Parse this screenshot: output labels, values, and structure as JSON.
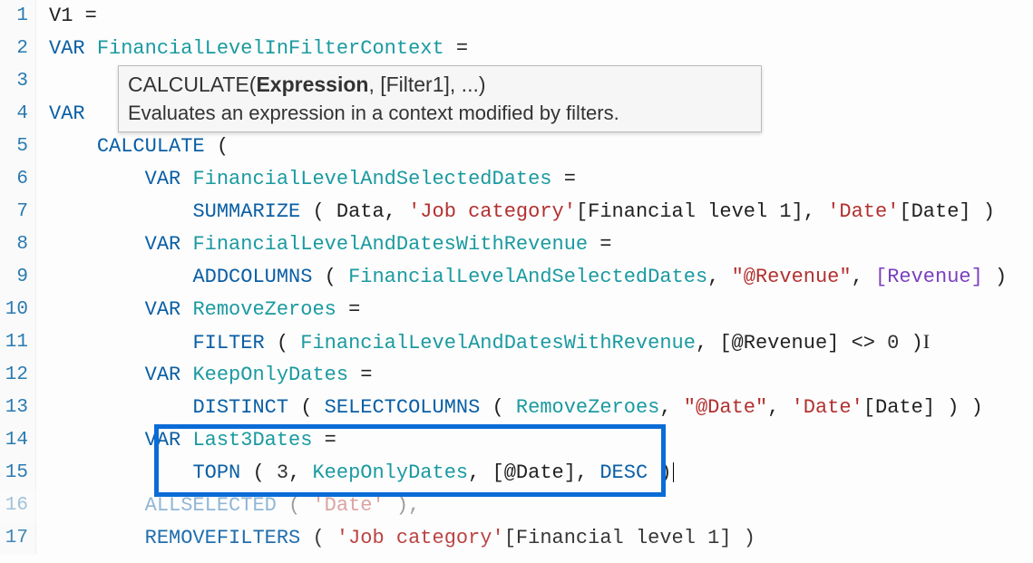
{
  "tooltip": {
    "signature_prefix": "CALCULATE(",
    "signature_bold": "Expression",
    "signature_suffix": ", [Filter1], ...)",
    "description": "Evaluates an expression in a context modified by filters."
  },
  "lines": {
    "l1": {
      "num": "1",
      "a": "V1 =",
      "ident": ""
    },
    "l2": {
      "num": "2",
      "kw": "VAR",
      "ident": "FinancialLevelInFilterContext",
      "rest": " ="
    },
    "l3": {
      "num": "3"
    },
    "l4": {
      "num": "4",
      "kw": "VAR"
    },
    "l5": {
      "num": "5",
      "fn": "CALCULATE",
      "rest": " ("
    },
    "l6": {
      "num": "6",
      "kw": "VAR",
      "ident": "FinancialLevelAndSelectedDates",
      "rest": " ="
    },
    "l7": {
      "num": "7",
      "fn": "SUMMARIZE",
      "rest1": " ( Data, ",
      "str1": "'Job category'",
      "rest2": "[Financial level 1], ",
      "str2": "'Date'",
      "rest3": "[Date] )"
    },
    "l8": {
      "num": "8",
      "kw": "VAR",
      "ident": "FinancialLevelAndDatesWithRevenue",
      "rest": " ="
    },
    "l9": {
      "num": "9",
      "fn": "ADDCOLUMNS",
      "rest1": " ( ",
      "ident2": "FinancialLevelAndSelectedDates",
      "rest2": ", ",
      "str1": "\"@Revenue\"",
      "rest3": ", ",
      "col1": "[Revenue]",
      "rest4": " )"
    },
    "l10": {
      "num": "10",
      "kw": "VAR",
      "ident": "RemoveZeroes",
      "rest": " ="
    },
    "l11": {
      "num": "11",
      "fn": "FILTER",
      "rest1": " ( ",
      "ident2": "FinancialLevelAndDatesWithRevenue",
      "rest2": ", [@Revenue] <> ",
      "num1": "0",
      "rest3": " )"
    },
    "l12": {
      "num": "12",
      "kw": "VAR",
      "ident": "KeepOnlyDates",
      "rest": " ="
    },
    "l13": {
      "num": "13",
      "fn1": "DISTINCT",
      "rest1": " ( ",
      "fn2": "SELECTCOLUMNS",
      "rest2": " ( ",
      "ident2": "RemoveZeroes",
      "rest3": ", ",
      "str1": "\"@Date\"",
      "rest4": ", ",
      "str2": "'Date'",
      "rest5": "[Date] ) )"
    },
    "l14": {
      "num": "14",
      "kw": "VAR",
      "ident": "Last3Dates",
      "rest": " ="
    },
    "l15": {
      "num": "15",
      "fn": "TOPN",
      "rest1": " ( ",
      "num1": "3",
      "rest2": ", ",
      "ident2": "KeepOnlyDates",
      "rest3": ", [@Date], ",
      "kw2": "DESC",
      "rest4": " )"
    },
    "l16": {
      "num": "16",
      "fn": "ALLSELECTED",
      "rest1": " ( ",
      "str1": "'Date'",
      "rest2": " ),"
    },
    "l17": {
      "num": "17",
      "fn": "REMOVEFILTERS",
      "rest1": " ( ",
      "str1": "'Job category'",
      "rest2": "[Financial level 1] )"
    }
  }
}
